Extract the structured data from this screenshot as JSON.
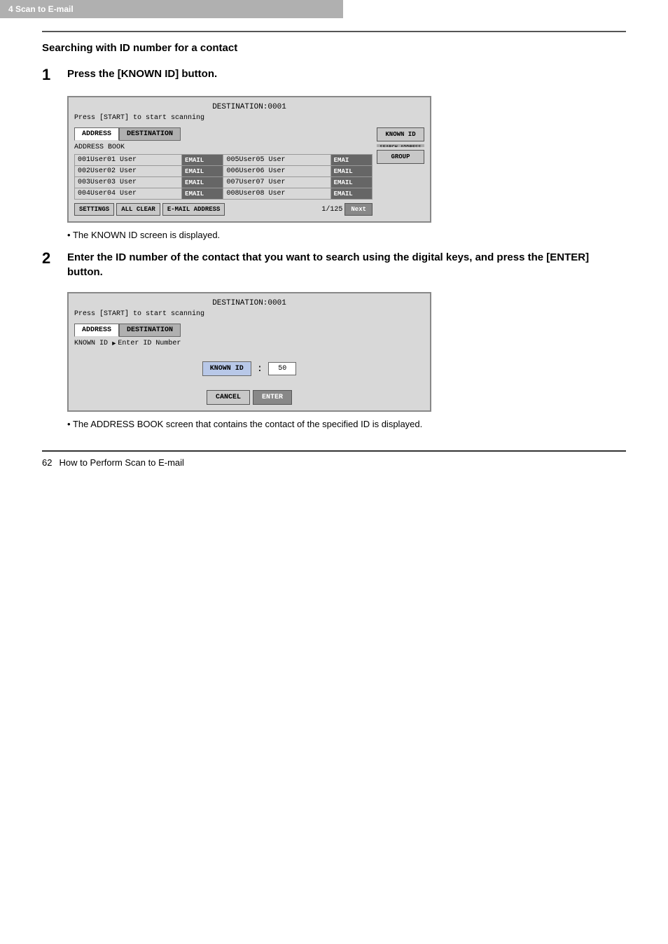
{
  "header": {
    "label": "4  Scan to E-mail"
  },
  "section": {
    "title": "Searching with ID number for a contact"
  },
  "step1": {
    "number": "1",
    "text": "Press the [KNOWN ID] button."
  },
  "step2": {
    "number": "2",
    "text": "Enter the ID number of the contact that you want to search using\nthe digital keys, and press the [ENTER] button."
  },
  "screen1": {
    "title": "DESTINATION:0001",
    "subtitle": "Press [START] to start scanning",
    "tab_address": "ADDRESS",
    "tab_destination": "DESTINATION",
    "address_book_label": "ADDRESS BOOK",
    "known_id_btn": "KNOWN ID",
    "group_btn": "GROUP",
    "users": [
      {
        "id": "001",
        "name": "User01 User",
        "tag": "EMAIL"
      },
      {
        "id": "002",
        "name": "User02 User",
        "tag": "EMAIL"
      },
      {
        "id": "003",
        "name": "User03 User",
        "tag": "EMAIL"
      },
      {
        "id": "004",
        "name": "User04 User",
        "tag": "EMAIL"
      },
      {
        "id": "005",
        "name": "User05 User",
        "tag": "EMAI"
      },
      {
        "id": "006",
        "name": "User06 User",
        "tag": "EMAIL"
      },
      {
        "id": "007",
        "name": "User07 User",
        "tag": "EMAIL"
      },
      {
        "id": "008",
        "name": "User08 User",
        "tag": "EMAIL"
      }
    ],
    "settings_btn": "SETTINGS",
    "all_clear_btn": "ALL CLEAR",
    "email_address_btn": "E-MAIL ADDRESS",
    "page_info": "1/125",
    "next_btn": "Next"
  },
  "bullet1": "The KNOWN ID screen is displayed.",
  "screen2": {
    "title": "DESTINATION:0001",
    "subtitle": "Press [START] to start scanning",
    "tab_address": "ADDRESS",
    "tab_destination": "DESTINATION",
    "known_id_label": "KNOWN ID",
    "enter_id_label": "Enter ID Number",
    "known_id_field": "KNOWN ID",
    "colon": ":",
    "id_value": "50",
    "cancel_btn": "CANCEL",
    "enter_btn": "ENTER"
  },
  "bullet2": "The ADDRESS BOOK screen that contains the contact of the specified ID is displayed.",
  "footer": {
    "page_number": "62",
    "text": "How to Perform Scan to E-mail"
  }
}
